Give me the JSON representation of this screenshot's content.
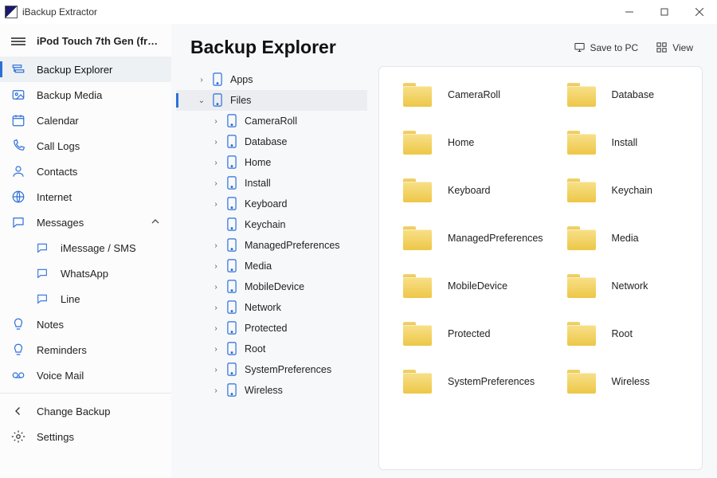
{
  "app": {
    "title": "iBackup Extractor"
  },
  "device": {
    "name": "iPod Touch 7th Gen (from To..."
  },
  "nav": {
    "backup_explorer": "Backup Explorer",
    "backup_media": "Backup Media",
    "calendar": "Calendar",
    "call_logs": "Call Logs",
    "contacts": "Contacts",
    "internet": "Internet",
    "messages": "Messages",
    "imessage": "iMessage / SMS",
    "whatsapp": "WhatsApp",
    "line": "Line",
    "notes": "Notes",
    "reminders": "Reminders",
    "voice_mail": "Voice Mail",
    "change_backup": "Change Backup",
    "settings": "Settings"
  },
  "header": {
    "title": "Backup Explorer",
    "save_to_pc": "Save to PC",
    "view": "View"
  },
  "tree": {
    "apps": "Apps",
    "files": "Files",
    "children": [
      "CameraRoll",
      "Database",
      "Home",
      "Install",
      "Keyboard",
      "Keychain",
      "ManagedPreferences",
      "Media",
      "MobileDevice",
      "Network",
      "Protected",
      "Root",
      "SystemPreferences",
      "Wireless"
    ]
  },
  "folders": [
    "CameraRoll",
    "Database",
    "Home",
    "Install",
    "Keyboard",
    "Keychain",
    "ManagedPreferences",
    "Media",
    "MobileDevice",
    "Network",
    "Protected",
    "Root",
    "SystemPreferences",
    "Wireless"
  ]
}
